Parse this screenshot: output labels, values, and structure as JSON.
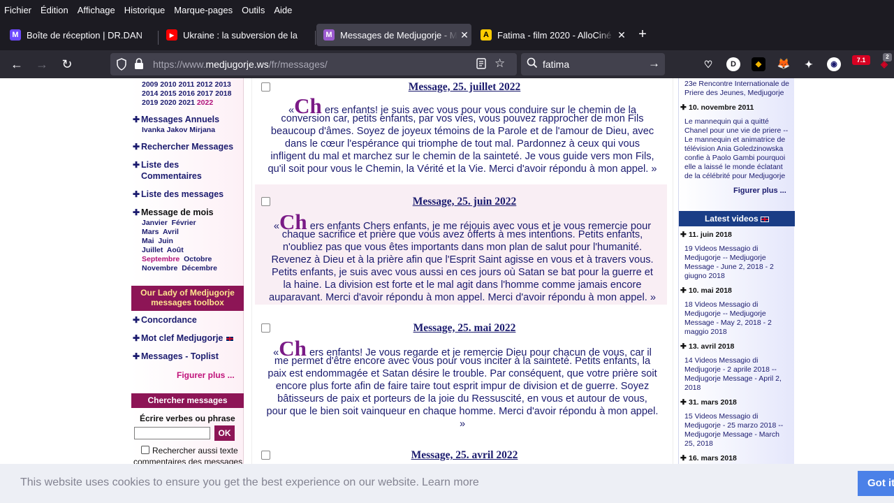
{
  "menubar": [
    "Fichier",
    "Édition",
    "Affichage",
    "Historique",
    "Marque-pages",
    "Outils",
    "Aide"
  ],
  "tabs": [
    {
      "label": "Boîte de réception | DR.DAN",
      "icon": "proton-mail-icon",
      "active": false
    },
    {
      "label": "Ukraine : la subversion de la",
      "icon": "youtube-icon",
      "active": false
    },
    {
      "label": "Messages de Medjugorje - M",
      "icon": "medjugorje-site-icon",
      "active": true
    },
    {
      "label": "Fatima - film 2020 - AlloCiné",
      "icon": "allocine-icon",
      "active": false
    }
  ],
  "urlbar": {
    "prefix": "https://www.",
    "domain": "medjugorje.ws",
    "path": "/fr/messages/"
  },
  "searchbar": {
    "query": "fatima"
  },
  "extensions": {
    "badge": "7.1",
    "badge2": "2",
    "avatar_letter": "D"
  },
  "left": {
    "years_line1": "2009 2010 2011 2012 2013",
    "years_line2": "2014 2015 2016 2017 2018",
    "years_line3_a": "2019 2020 2021 ",
    "years_line3_cur": "2022",
    "messages_annuels": "Messages Annuels",
    "visionaries": "Ivanka Jakov Mirjana",
    "rechercher": "Rechercher Messages",
    "liste_commentaires_1": "Liste des",
    "liste_commentaires_2": "Commentaires",
    "liste_messages": "Liste des messages",
    "message_de_mois": "Message de mois",
    "months": {
      "r1a": "Janvier",
      "r1b": "Février",
      "r2a": "Mars",
      "r2b": "Avril",
      "r3a": "Mai",
      "r3b": "Juin",
      "r4a": "Juillet",
      "r4b": "Août",
      "r5a": "Septembre",
      "r5b": "Octobre",
      "r6a": "Novembre",
      "r6b": "Décembre"
    },
    "toolbox_1": "Our Lady of Medjugorje",
    "toolbox_2": "messages toolbox",
    "concordance": "Concordance",
    "mot_clef": "Mot clef Medjugorje",
    "toplist": "Messages - Toplist",
    "figurer_plus": "Figurer plus ...",
    "chercher_messages": "Chercher messages",
    "ecrire": "Écrire verbes ou phrase",
    "ok": "OK",
    "checkbox_label_1": "Rechercher aussi texte",
    "checkbox_label_2": "commentaires des messages"
  },
  "messages": [
    {
      "title": "Message, 25. juillet 2022",
      "open": "«",
      "big": "Ch",
      "line1": "ers enfants! je suis avec vous pour vous conduire sur le chemin de la",
      "line2": "conversion car, petits enfants, par vos vies, vous pouvez rapprocher de mon Fils",
      "line3": "beaucoup d'âmes. Soyez de joyeux témoins de la Parole et de l'amour de Dieu, avec",
      "line4": "dans le cœur l'espérance qui triomphe de tout mal. Pardonnez à ceux qui vous",
      "line5": "infligent du mal et marchez sur le chemin de la sainteté. Je vous guide vers mon Fils,",
      "line6": "qu'il soit pour vous le Chemin, la Vérité et la Vie. Merci d'avoir répondu à mon appel. »"
    },
    {
      "title": "Message, 25. juin 2022",
      "open": "«",
      "big": "Ch",
      "line1": "ers enfants Chers enfants, je me réjouis avec vous et je vous remercie pour",
      "line2": "chaque sacrifice et prière que vous avez offerts à mes intentions. Petits enfants,",
      "line3": "n'oubliez pas que vous êtes importants dans mon plan de salut pour l'humanité.",
      "line4": "Revenez à Dieu et à la prière afin que l'Esprit Saint agisse en vous et à travers vous.",
      "line5": "Petits enfants, je suis avec vous aussi en ces jours où Satan se bat pour la guerre et",
      "line6": "la haine. La division est forte et le mal agit dans l'homme comme jamais encore",
      "line7": "auparavant. Merci d'avoir répondu à mon appel. Merci d'avoir répondu à mon appel. »"
    },
    {
      "title": "Message, 25. mai 2022",
      "open": "«",
      "big": "Ch",
      "line1": "ers enfants! Je vous regarde et je remercie Dieu pour chacun de vous, car il",
      "line2": "me permet d'être encore avec vous pour vous inciter à la sainteté. Petits enfants, la",
      "line3": "paix est endommagée et Satan désire le trouble. Par conséquent, que votre prière soit",
      "line4": "encore plus forte afin de faire taire tout esprit impur de division et de guerre. Soyez",
      "line5": "bâtisseurs de paix et porteurs de la joie du Ressuscité, en vous et autour de vous,",
      "line6": "pour que le bien soit vainqueur en chaque homme. Merci d'avoir répondu à mon appel.",
      "line7": "»"
    },
    {
      "title": "Message, 25. avril 2022"
    }
  ],
  "right": {
    "top_line1": "23e Rencontre Internationale de",
    "top_line2": "Priere des Jeunes, Medjugorje",
    "date1": "10. novembre 2011",
    "text1_1": "Le mannequin qui a quitté",
    "text1_2": "Chanel pour une vie de priere --",
    "text1_3": "Le mannequin et animatrice de",
    "text1_4": "télévision Ania Goledzinowska",
    "text1_5": "confie à Paolo Gambi pourquoi",
    "text1_6": "elle a laissé le monde éclatant",
    "text1_7": "de la célébrité pour Medjugorje",
    "figurer_plus": "Figurer plus ...",
    "videos_head": "Latest videos",
    "videos": [
      {
        "date": "11. juin 2018",
        "l1": "19 Videos Messagio di",
        "l2": "Medjugorje -- Medjugorje",
        "l3": "Message - June 2, 2018 - 2",
        "l4": "giugno 2018"
      },
      {
        "date": "10. mai 2018",
        "l1": "18 Videos Messagio di",
        "l2": "Medjugorje -- Medjugorje",
        "l3": "Message - May 2, 2018 - 2",
        "l4": "maggio 2018"
      },
      {
        "date": "13. avril 2018",
        "l1": "14 Videos Messagio di",
        "l2": "Medjugorje - 2 aprile 2018 --",
        "l3": "Medjugorje Message - April 2,",
        "l4": "2018"
      },
      {
        "date": "31. mars 2018",
        "l1": "15 Videos Messagio di",
        "l2": "Medjugorje - 25 marzo 2018 --",
        "l3": "Medjugorje Message - March",
        "l4": "25, 2018"
      },
      {
        "date": "16. mars 2018"
      }
    ]
  },
  "cookie": {
    "text": "This website uses cookies to ensure you get the best experience on our website.",
    "link": "Learn more",
    "button": "Got it"
  },
  "colors": {
    "accent_pink": "#8d1556",
    "navy": "#1b1b6e",
    "video_blue": "#1a3d86",
    "cookie_button": "#4b81e8"
  }
}
